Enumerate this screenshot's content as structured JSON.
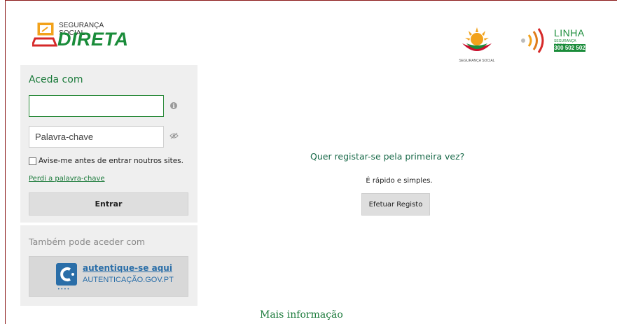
{
  "header": {
    "logo_small_text": "SEGURANÇA SOCIAL",
    "logo_big_text": "DIRETA",
    "seg_logo_caption": "SEGURANÇA SOCIAL",
    "linha_title": "LINHA",
    "linha_sub": "SEGURANÇA SOCIAL",
    "linha_phone": "300 502 502"
  },
  "login": {
    "title": "Aceda com",
    "user_value": "",
    "password_placeholder": "Palavra-chave",
    "remember_label": "Avise-me antes de entrar noutros sites.",
    "forgot_link": "Perdi a palavra-chave",
    "enter_button": "Entrar"
  },
  "alt_login": {
    "title": "Também pode aceder com",
    "gov_line1": "autentique-se aqui",
    "gov_line2": "AUTENTICAÇÃO.GOV.PT",
    "gov_dots": "••••"
  },
  "register": {
    "title": "Quer registar-se pela primeira vez?",
    "subtitle": "É rápido e simples.",
    "button": "Efetuar Registo"
  },
  "footer": {
    "more_info": "Mais informação"
  },
  "colors": {
    "brand_green": "#1a8c3a",
    "panel_bg": "#efefef",
    "gov_blue": "#2a6ea8",
    "frame_border": "#8b1a1a"
  }
}
